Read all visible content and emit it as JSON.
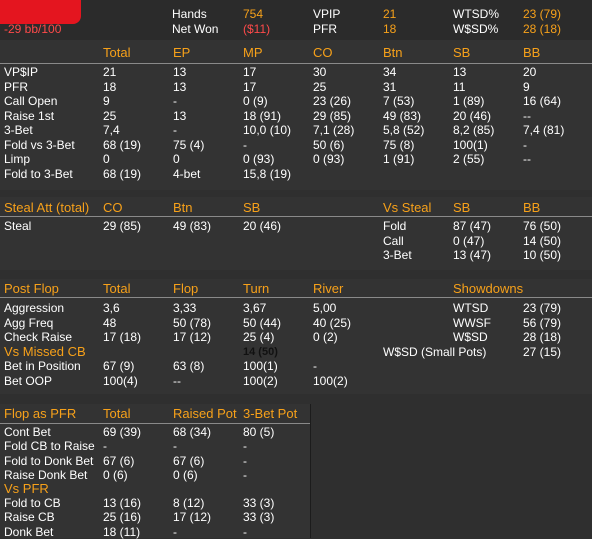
{
  "header": {
    "bb_result": "-29 bb/100",
    "hands_label": "Hands",
    "hands_value": "754",
    "netwon_label": "Net Won",
    "netwon_value": "($11)",
    "vpip_label": "VPIP",
    "vpip_value": "21",
    "pfr_label": "PFR",
    "pfr_value": "18",
    "wtsd_label": "WTSD%",
    "wtsd_value": "23 (79)",
    "wsd_label": "W$SD%",
    "wsd_value": "28 (18)"
  },
  "positions": {
    "columns": [
      "Total",
      "EP",
      "MP",
      "CO",
      "Btn",
      "SB",
      "BB"
    ],
    "rows": [
      {
        "label": "VP$IP",
        "cells": [
          "21",
          "13",
          "17",
          "30",
          "34",
          "13",
          "20"
        ]
      },
      {
        "label": "PFR",
        "cells": [
          "18",
          "13",
          "17",
          "25",
          "31",
          "11",
          "9"
        ]
      },
      {
        "label": "Call Open",
        "cells": [
          "9",
          "-",
          "0 (9)",
          "23 (26)",
          "7 (53)",
          "1 (89)",
          "16 (64)"
        ]
      },
      {
        "label": "Raise 1st",
        "cells": [
          "25",
          "13",
          "18 (91)",
          "29 (85)",
          "49 (83)",
          "20 (46)",
          "--"
        ]
      },
      {
        "label": "3-Bet",
        "cells": [
          "7,4",
          "-",
          "10,0 (10)",
          "7,1 (28)",
          "5,8 (52)",
          "8,2 (85)",
          "7,4 (81)"
        ]
      },
      {
        "label": "Fold vs 3-Bet",
        "cells": [
          "68 (19)",
          "75 (4)",
          "-",
          "50 (6)",
          "75 (8)",
          "100(1)",
          "-"
        ]
      },
      {
        "label": "Limp",
        "cells": [
          "0",
          "0",
          "0 (93)",
          "0 (93)",
          "1 (91)",
          "2 (55)",
          "--"
        ]
      },
      {
        "label": "Fold to 3-Bet",
        "cells": [
          "68 (19)",
          "4-bet",
          "15,8 (19)",
          "",
          "",
          "",
          ""
        ]
      }
    ]
  },
  "steal": {
    "title": "Steal Att (total)",
    "columns": [
      "CO",
      "Btn",
      "SB"
    ],
    "row_label": "Steal",
    "cells": [
      "29 (85)",
      "49 (83)",
      "20 (46)"
    ],
    "vs_title": "Vs Steal",
    "vs_columns": [
      "SB",
      "BB"
    ],
    "vs_rows": [
      {
        "label": "Fold",
        "cells": [
          "87 (47)",
          "76 (50)"
        ]
      },
      {
        "label": "Call",
        "cells": [
          "0 (47)",
          "14 (50)"
        ]
      },
      {
        "label": "3-Bet",
        "cells": [
          "13 (47)",
          "10 (50)"
        ]
      }
    ]
  },
  "postflop": {
    "title": "Post Flop",
    "columns": [
      "Total",
      "Flop",
      "Turn",
      "River"
    ],
    "rows": [
      {
        "label": "Aggression",
        "cells": [
          "3,6",
          "3,33",
          "3,67",
          "5,00"
        ]
      },
      {
        "label": "Agg Freq",
        "cells": [
          "48",
          "50 (78)",
          "50 (44)",
          "40 (25)"
        ]
      },
      {
        "label": "Check Raise",
        "cells": [
          "17 (18)",
          "17 (12)",
          "25 (4)",
          "0 (2)"
        ]
      }
    ],
    "missed_title": "Vs Missed CB",
    "missed_hidden": "14 (50)",
    "missed_rows": [
      {
        "label": "Bet in Position",
        "cells": [
          "67 (9)",
          "63 (8)",
          "100(1)",
          "-"
        ]
      },
      {
        "label": "Bet OOP",
        "cells": [
          "100(4)",
          "--",
          "100(2)",
          "100(2)"
        ]
      }
    ],
    "showdowns_title": "Showdowns",
    "showdowns": [
      {
        "label": "WTSD",
        "value": "23 (79)"
      },
      {
        "label": "WWSF",
        "value": "56 (79)"
      },
      {
        "label": "W$SD",
        "value": "28 (18)"
      },
      {
        "label": "W$SD (Small Pots)",
        "value": "27 (15)"
      }
    ]
  },
  "pfr": {
    "title": "Flop as PFR",
    "columns": [
      "Total",
      "Raised Pot",
      "3-Bet Pot"
    ],
    "rows": [
      {
        "label": "Cont Bet",
        "cells": [
          "69 (39)",
          "68 (34)",
          "80 (5)"
        ]
      },
      {
        "label": "Fold CB to Raise",
        "cells": [
          "-",
          "-",
          "-"
        ]
      },
      {
        "label": "Fold to Donk Bet",
        "cells": [
          "67 (6)",
          "67 (6)",
          "-"
        ]
      },
      {
        "label": "Raise Donk Bet",
        "cells": [
          "0 (6)",
          "0 (6)",
          "-"
        ]
      }
    ],
    "vs_title": "Vs PFR",
    "vs_rows": [
      {
        "label": "Fold to CB",
        "cells": [
          "13 (16)",
          "8 (12)",
          "33 (3)"
        ]
      },
      {
        "label": "Raise CB",
        "cells": [
          "25 (16)",
          "17 (12)",
          "33 (3)"
        ]
      },
      {
        "label": "Donk Bet",
        "cells": [
          "18 (11)",
          "-",
          "-"
        ]
      }
    ]
  }
}
